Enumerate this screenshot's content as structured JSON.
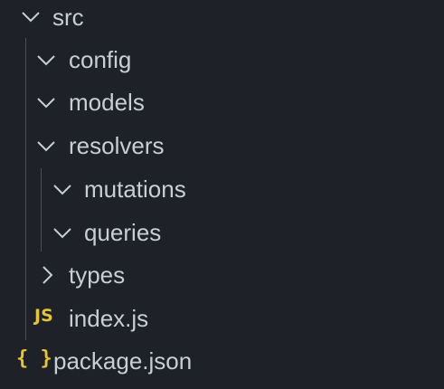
{
  "explorer": {
    "items": [
      {
        "label": "src",
        "icon": "chevron-down-icon"
      },
      {
        "label": "config",
        "icon": "chevron-down-icon"
      },
      {
        "label": "models",
        "icon": "chevron-down-icon"
      },
      {
        "label": "resolvers",
        "icon": "chevron-down-icon"
      },
      {
        "label": "mutations",
        "icon": "chevron-down-icon"
      },
      {
        "label": "queries",
        "icon": "chevron-down-icon"
      },
      {
        "label": "types",
        "icon": "chevron-right-icon"
      },
      {
        "label": "index.js",
        "icon": "js-file-icon",
        "badge": "JS"
      },
      {
        "label": "package.json",
        "icon": "json-file-icon",
        "badge": "{ }"
      }
    ]
  },
  "colors": {
    "background": "#1e2127",
    "text": "#c9ced6",
    "chevron": "#c9ced6",
    "indent_guide": "#4a4f58",
    "js_badge": "#e5c33c",
    "json_badge": "#e5c33c"
  }
}
